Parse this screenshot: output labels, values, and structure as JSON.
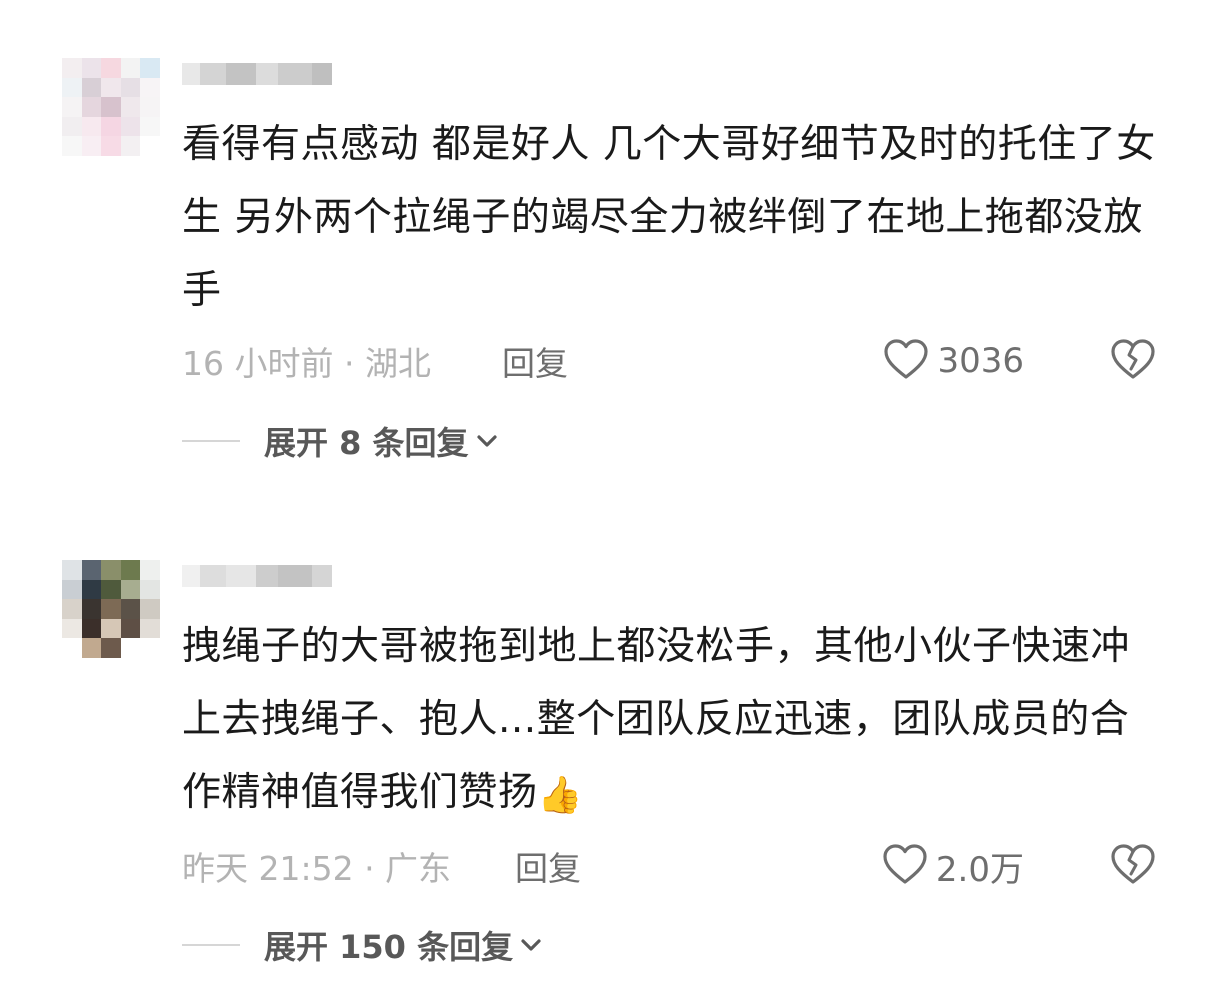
{
  "comments": [
    {
      "text": "看得有点感动 都是好人 几个大哥好细节及时的托住了女生 另外两个拉绳子的竭尽全力被绊倒了在地上拖都没放手",
      "emoji": "",
      "time_location": "16 小时前 · 湖北",
      "reply_label": "回复",
      "likes": "3036",
      "expand_label": "展开 8 条回复",
      "avatar_colors": [
        "#f3eef0",
        "#ece3ea",
        "#f6d8e0",
        "#f3f3f3",
        "#d9e9f3",
        "#eef2f5",
        "#d8cfd6",
        "#f0e7ec",
        "#e6dfe5",
        "#f7f4f6",
        "#f5f3f4",
        "#e5d6de",
        "#d7c2cd",
        "#efe8ec",
        "#f6f4f5",
        "#f1eef0",
        "#f7e9ef",
        "#f5d6e3",
        "#ede3ea",
        "#f7f7f7",
        "#f7f7f7",
        "#f8eef3",
        "#f7dbe6",
        "#f3f0f2",
        "#ffffff"
      ],
      "username_colors": [
        "#e6e6e6",
        "#cfcfcf",
        "#bdbdbd",
        "#d8d8d8",
        "#c7c7c7",
        "#b8b8b8"
      ]
    },
    {
      "text": "拽绳子的大哥被拖到地上都没松手，其他小伙子快速冲上去拽绳子、抱人...整个团队反应迅速，团队成员的合作精神值得我们赞扬",
      "emoji": "👍",
      "time_location": "昨天 21:52 · 广东",
      "reply_label": "回复",
      "likes": "2.0万",
      "expand_label": "展开 150 条回复",
      "avatar_colors": [
        "#dfe3e6",
        "#5a6470",
        "#8a8f6a",
        "#6d7a4e",
        "#eef0ee",
        "#c9ced3",
        "#2f3a44",
        "#4f5a3c",
        "#a7ad90",
        "#e3e5e3",
        "#d8d2ca",
        "#3a3430",
        "#7d6a55",
        "#5b5248",
        "#cfcac2",
        "#ece8e3",
        "#3b2f2a",
        "#d6c7b6",
        "#5e4f45",
        "#e2ddd7",
        "#ffffff",
        "#c1a98f",
        "#6d5a4c",
        "#ffffff",
        "#ffffff"
      ],
      "username_colors": [
        "#eeeeee",
        "#d9d9d9",
        "#e3e3e3",
        "#c8c8c8",
        "#bcbcbc",
        "#d0d0d0"
      ]
    }
  ],
  "colors": {
    "text": "#1a1a1a",
    "meta": "#b3b3b3",
    "action": "#6e6e6e",
    "expand": "#585858"
  },
  "icons": {
    "like": "heart-outline-icon",
    "dislike": "broken-heart-icon",
    "expand": "chevron-down-icon"
  }
}
